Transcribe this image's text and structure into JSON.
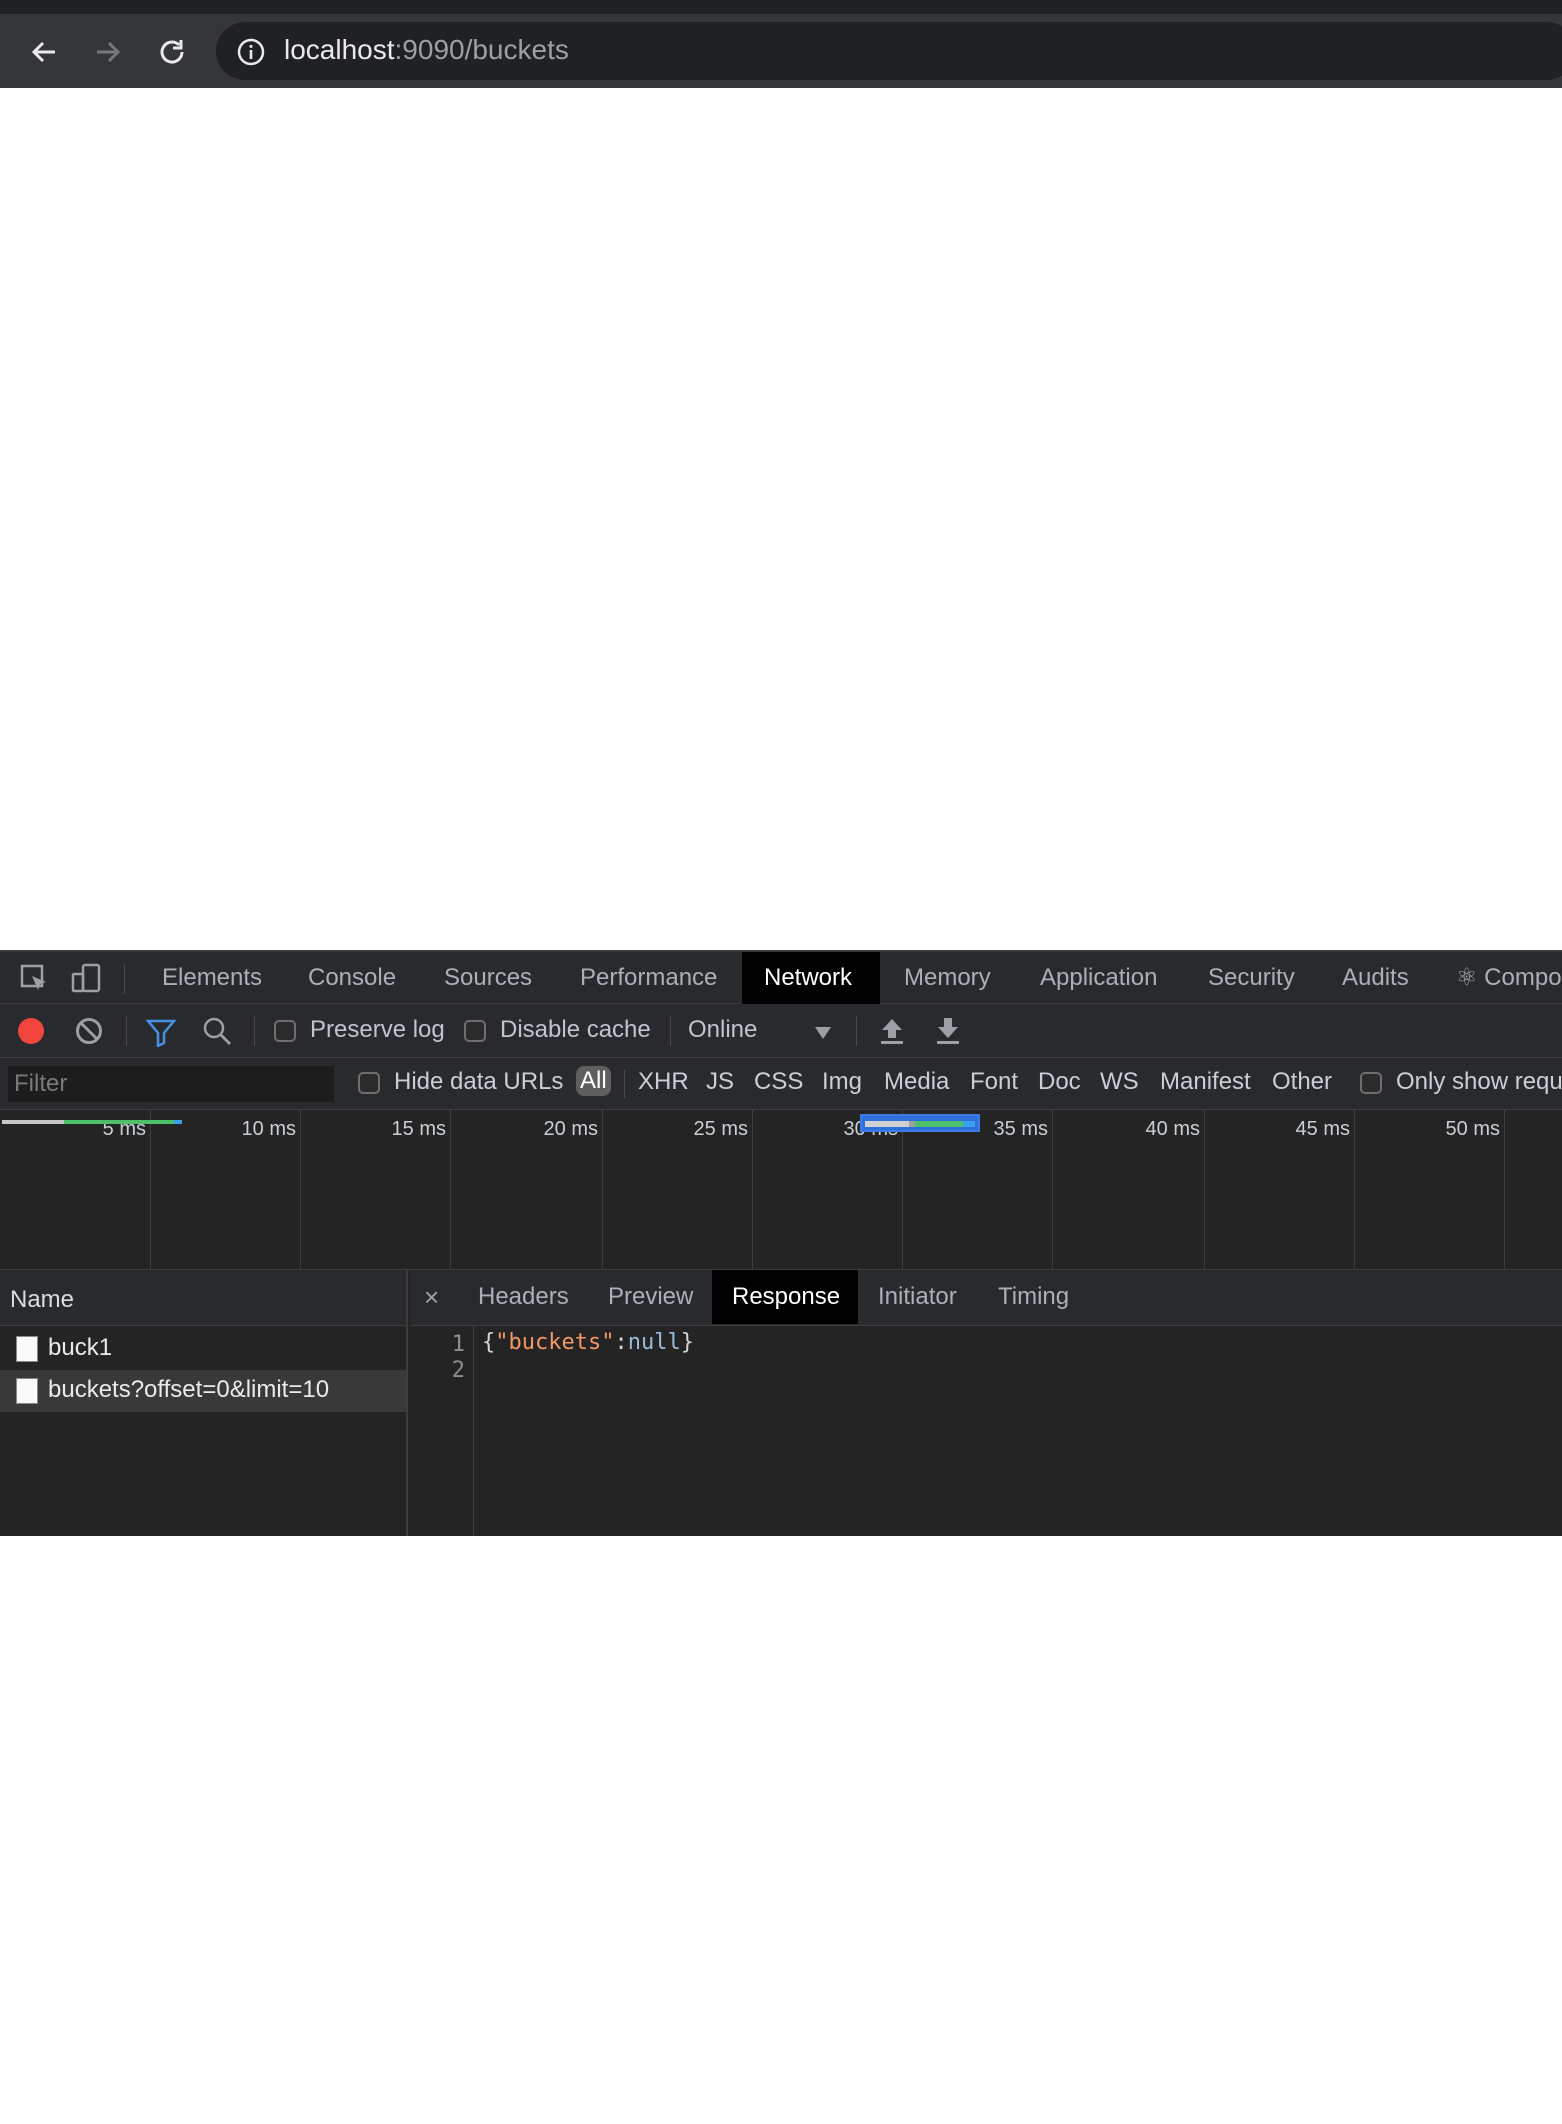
{
  "browser": {
    "url_host": "localhost",
    "url_rest": ":9090/buckets"
  },
  "devtools": {
    "tabs": [
      "Elements",
      "Console",
      "Sources",
      "Performance",
      "Network",
      "Memory",
      "Application",
      "Security",
      "Audits",
      "⚛ Compon"
    ],
    "active_tab": "Network",
    "toolbar": {
      "preserve_log": "Preserve log",
      "disable_cache": "Disable cache",
      "throttle": "Online"
    },
    "filter": {
      "placeholder": "Filter",
      "hide_data_urls": "Hide data URLs",
      "types": [
        "All",
        "XHR",
        "JS",
        "CSS",
        "Img",
        "Media",
        "Font",
        "Doc",
        "WS",
        "Manifest",
        "Other"
      ],
      "active_type": "All",
      "only_show": "Only show requ"
    },
    "timeline": {
      "ticks": [
        "5 ms",
        "10 ms",
        "15 ms",
        "20 ms",
        "25 ms",
        "30 ms",
        "35 ms",
        "40 ms",
        "45 ms",
        "50 ms"
      ]
    },
    "requests": {
      "header": "Name",
      "items": [
        "buck1",
        "buckets?offset=0&limit=10"
      ]
    },
    "detail": {
      "close": "×",
      "tabs": [
        "Headers",
        "Preview",
        "Response",
        "Initiator",
        "Timing"
      ],
      "active_tab": "Response",
      "line_numbers": [
        "1",
        "2"
      ],
      "response": {
        "open": "{",
        "key": "\"buckets\"",
        "colon": ":",
        "value": "null",
        "close": "}"
      }
    }
  },
  "colors": {
    "record_red": "#f1453d",
    "filter_blue": "#4a90e2"
  }
}
